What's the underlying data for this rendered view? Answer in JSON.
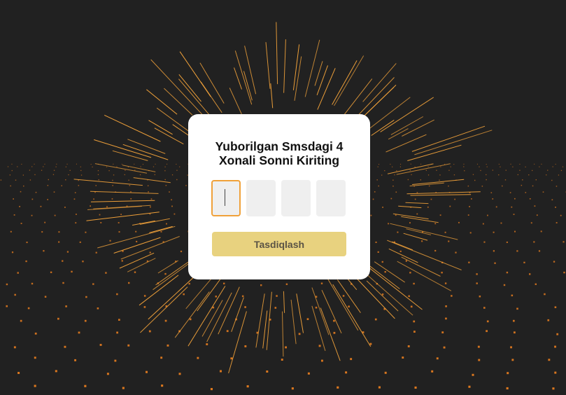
{
  "theme": {
    "background": "#212121",
    "accent": "#f0a13a",
    "particle_color": "#e07a1f",
    "card_background": "#ffffff",
    "button_background": "#e8d27f"
  },
  "dialog": {
    "title_line1": "Yuborilgan Smsdagi 4",
    "title_line2": "Xonali Sonni Kiriting",
    "otp_digits": [
      "",
      "",
      "",
      ""
    ],
    "active_index": 0,
    "confirm_label": "Tasdiqlash"
  }
}
